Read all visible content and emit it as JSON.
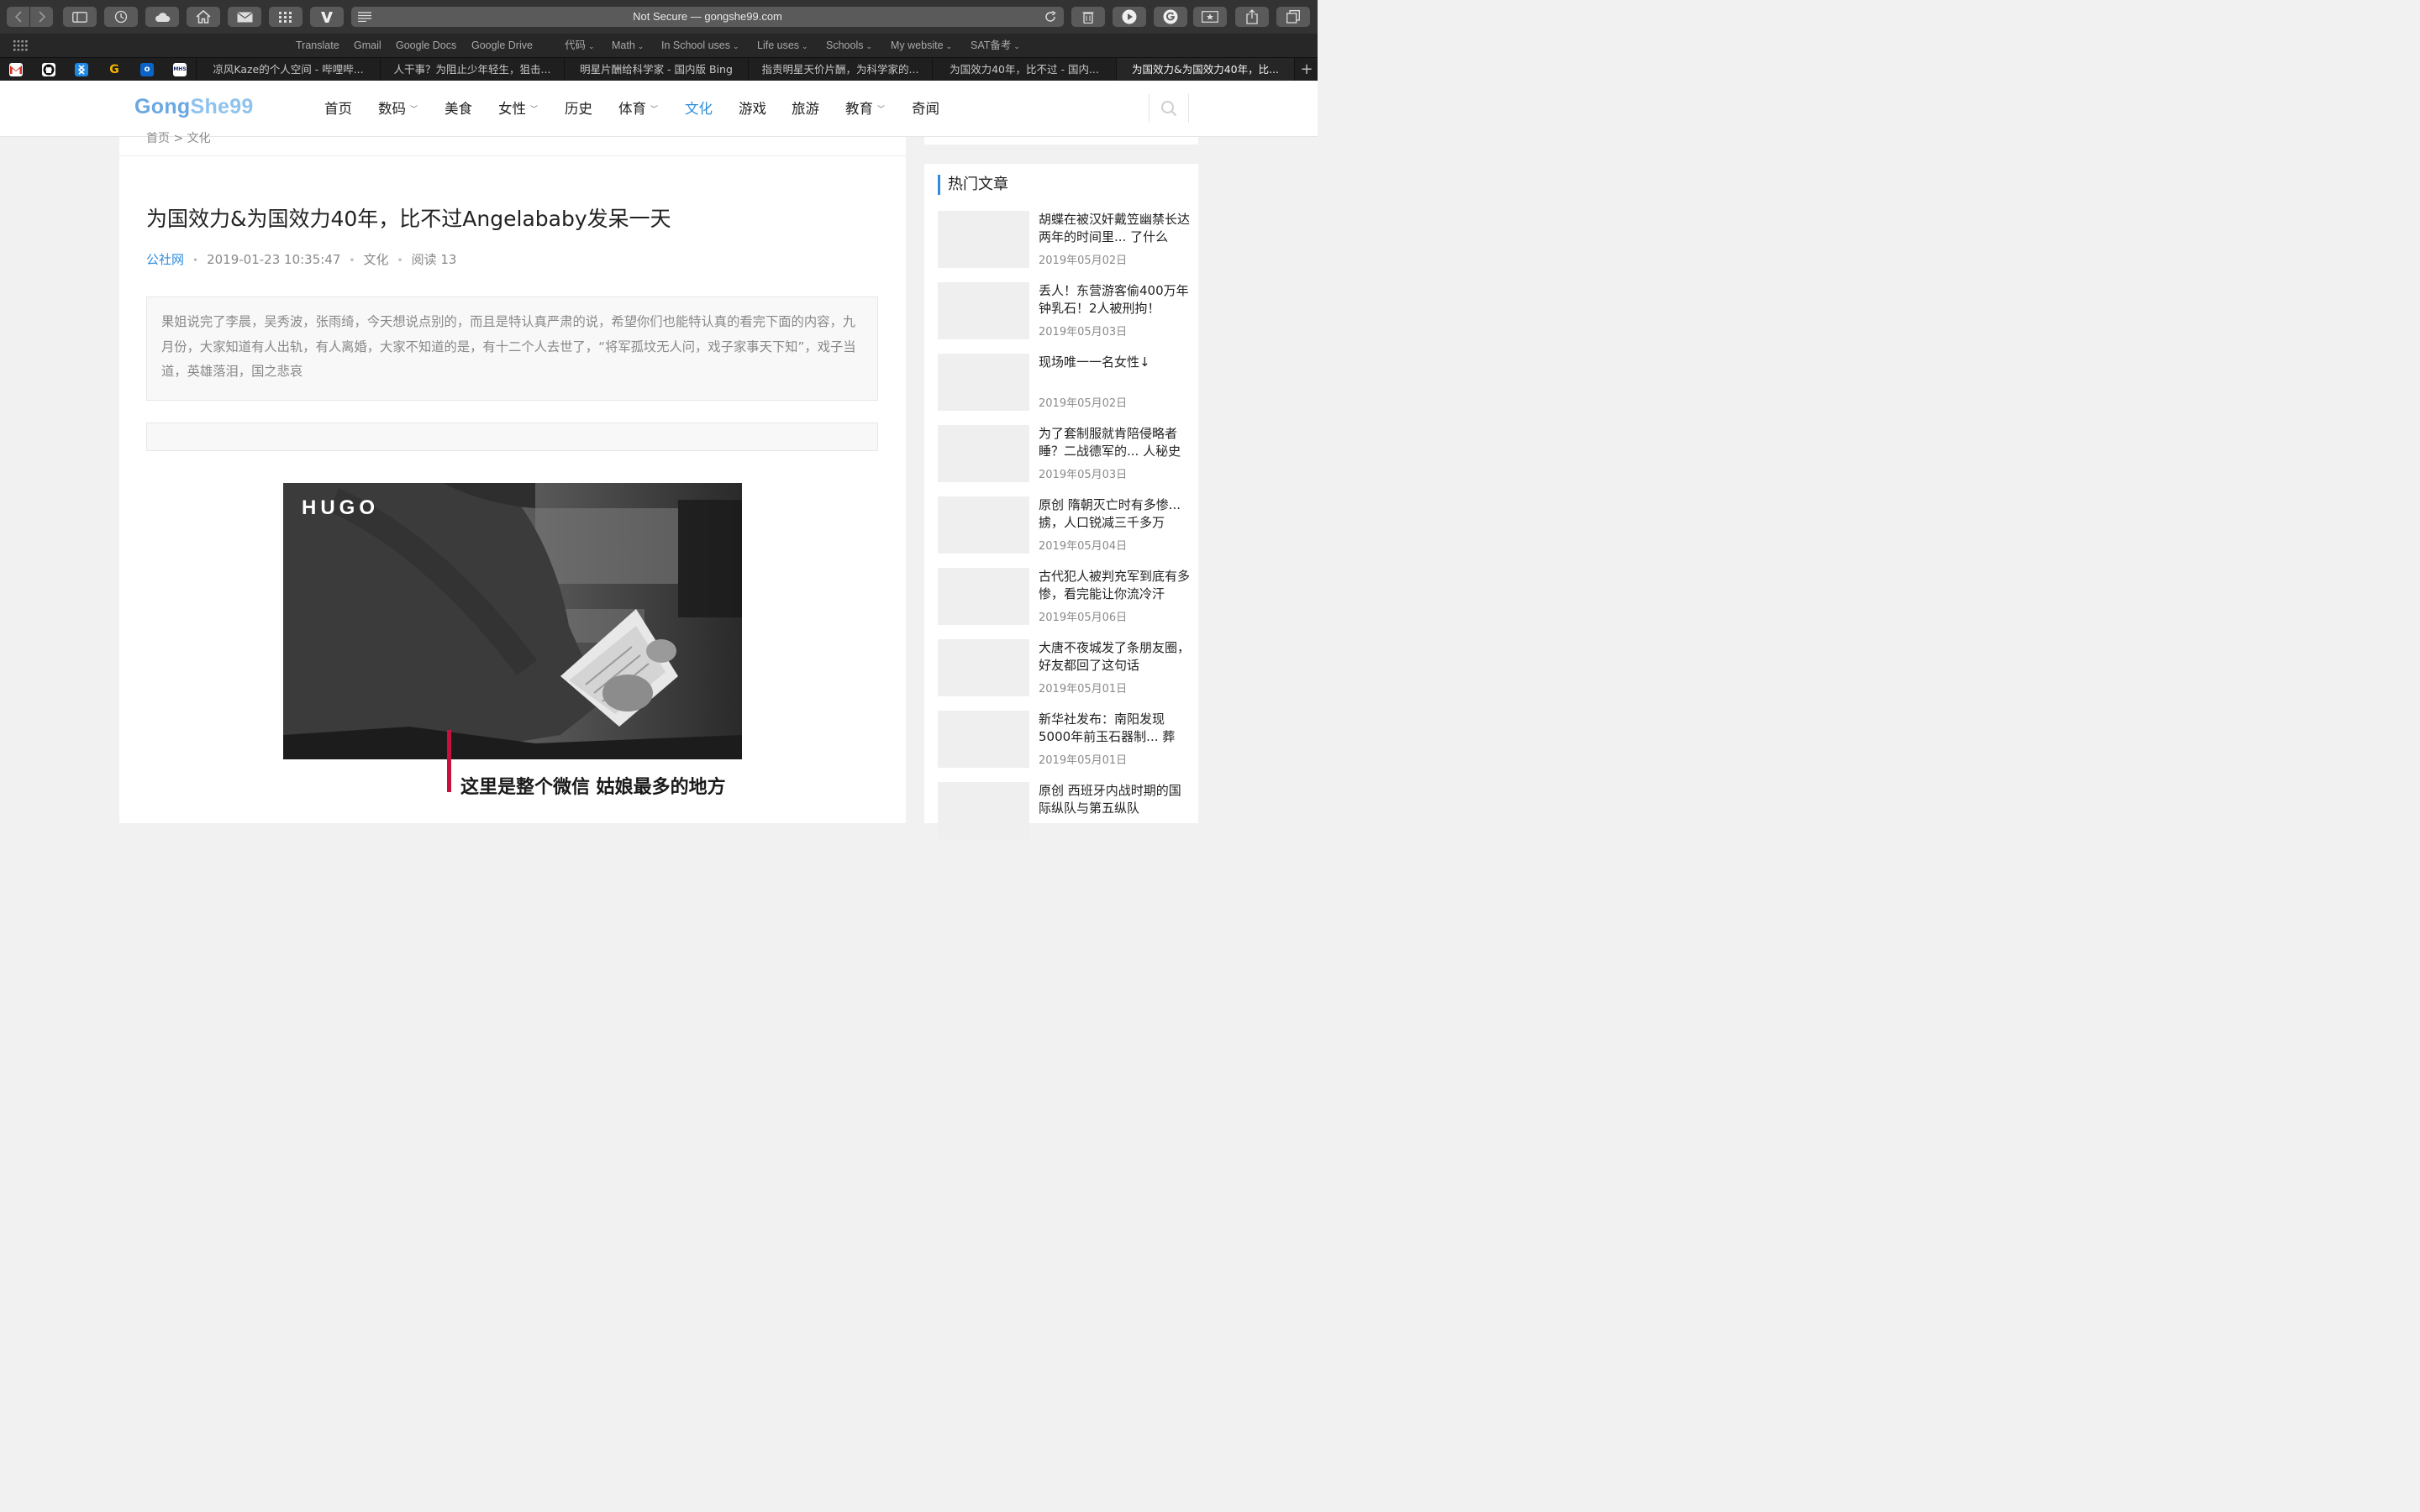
{
  "browser": {
    "url_display": "Not Secure — gongshe99.com",
    "bookmarks": [
      {
        "label": "Translate",
        "dropdown": false
      },
      {
        "label": "Gmail",
        "dropdown": false
      },
      {
        "label": "Google Docs",
        "dropdown": false
      },
      {
        "label": "Google Drive",
        "dropdown": false
      },
      {
        "label": "代码",
        "dropdown": true
      },
      {
        "label": "Math",
        "dropdown": true
      },
      {
        "label": "In School uses",
        "dropdown": true
      },
      {
        "label": "Life uses",
        "dropdown": true
      },
      {
        "label": "Schools",
        "dropdown": true
      },
      {
        "label": "My website",
        "dropdown": true
      },
      {
        "label": "SAT备考",
        "dropdown": true
      }
    ],
    "pinned_icons": [
      "gmail-icon",
      "github-icon",
      "app-icon",
      "g-icon",
      "outlook-icon",
      "mhs-icon"
    ],
    "pinned_labels": {
      "g": "G",
      "outlook": "o",
      "mhs": "MHS"
    },
    "tabs": [
      {
        "label": "凉风Kaze的个人空间 - 哔哩哔...",
        "active": false
      },
      {
        "label": "人干事？为阻止少年轻生，狙击...",
        "active": false
      },
      {
        "label": "明星片酬给科学家 - 国内版 Bing",
        "active": false
      },
      {
        "label": "指责明星天价片酬，为科学家的...",
        "active": false
      },
      {
        "label": "为国效力40年，比不过 - 国内...",
        "active": false
      },
      {
        "label": "为国效力&为国效力40年，比...",
        "active": true
      }
    ],
    "new_tab_symbol": "+"
  },
  "site": {
    "logo_part1": "Gong",
    "logo_part2": "She99",
    "nav": [
      {
        "label": "首页",
        "dropdown": false,
        "active": false
      },
      {
        "label": "数码",
        "dropdown": true,
        "active": false
      },
      {
        "label": "美食",
        "dropdown": false,
        "active": false
      },
      {
        "label": "女性",
        "dropdown": true,
        "active": false
      },
      {
        "label": "历史",
        "dropdown": false,
        "active": false
      },
      {
        "label": "体育",
        "dropdown": true,
        "active": false
      },
      {
        "label": "文化",
        "dropdown": false,
        "active": true
      },
      {
        "label": "游戏",
        "dropdown": false,
        "active": false
      },
      {
        "label": "旅游",
        "dropdown": false,
        "active": false
      },
      {
        "label": "教育",
        "dropdown": true,
        "active": false
      },
      {
        "label": "奇闻",
        "dropdown": false,
        "active": false
      }
    ]
  },
  "article": {
    "breadcrumb": "首页 > 文化",
    "title": "为国效力&为国效力40年，比不过Angelababy发呆一天",
    "source": "公社网",
    "datetime": "2019-01-23 10:35:47",
    "category": "文化",
    "reads": "阅读 13",
    "summary": "果姐说完了李晨，吴秀波，张雨绮，今天想说点别的，而且是特认真严肃的说，希望你们也能特认真的看完下面的内容，九月份，大家知道有人出轨，有人离婚，大家不知道的是，有十二个人去世了，“将军孤坟无人问，戏子家事天下知”，戏子当道，英雄落泪，国之悲哀",
    "image_brand": "HUGO",
    "image_caption": "这里是整个微信  姑娘最多的地方"
  },
  "sidebar": {
    "title": "热门文章",
    "items": [
      {
        "title": "胡蝶在被汉奸戴笠幽禁长达两年的时间里... 了什么",
        "date": "2019年05月02日"
      },
      {
        "title": "丢人！东营游客偷400万年钟乳石！2人被刑拘！",
        "date": "2019年05月03日"
      },
      {
        "title": "现场唯一一名女性↓",
        "date": "2019年05月02日"
      },
      {
        "title": "为了套制服就肯陪侵略者睡？二战德军的... 人秘史",
        "date": "2019年05月03日"
      },
      {
        "title": "原创 隋朝灭亡时有多惨... 掳，人口锐减三千多万",
        "date": "2019年05月04日"
      },
      {
        "title": "古代犯人被判充军到底有多惨，看完能让你流冷汗",
        "date": "2019年05月06日"
      },
      {
        "title": "大唐不夜城发了条朋友圈，好友都回了这句话",
        "date": "2019年05月01日"
      },
      {
        "title": "新华社发布：南阳发现5000年前玉石器制... 葬",
        "date": "2019年05月01日"
      },
      {
        "title": "原创 西班牙内战时期的国际纵队与第五纵队",
        "date": ""
      }
    ]
  },
  "colors": {
    "accent": "#2d8cdc",
    "caption_bar": "#c8103e",
    "chrome_dark": "#272727"
  }
}
